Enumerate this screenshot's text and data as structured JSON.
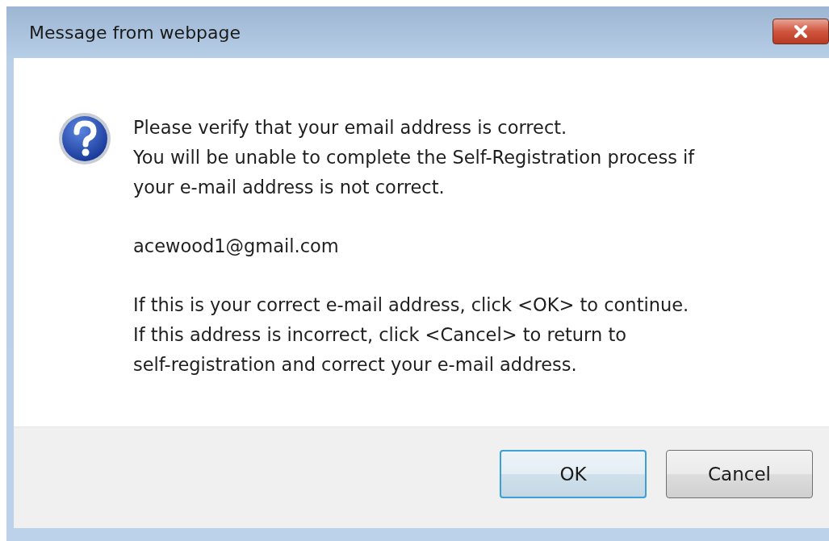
{
  "window": {
    "title": "Message from webpage"
  },
  "message": {
    "paragraphs": [
      {
        "lines": [
          "Please verify that your email address is correct.",
          "You will be unable to complete the Self-Registration process if",
          "your e-mail address is not correct."
        ]
      },
      {
        "lines": [
          "acewood1@gmail.com"
        ]
      },
      {
        "lines": [
          "If this is your correct e-mail address, click <OK> to continue.",
          "If this address is incorrect, click <Cancel> to return to",
          "self-registration and correct your e-mail address."
        ]
      }
    ]
  },
  "buttons": [
    {
      "label": "OK",
      "default": true
    },
    {
      "label": "Cancel",
      "default": false
    }
  ]
}
